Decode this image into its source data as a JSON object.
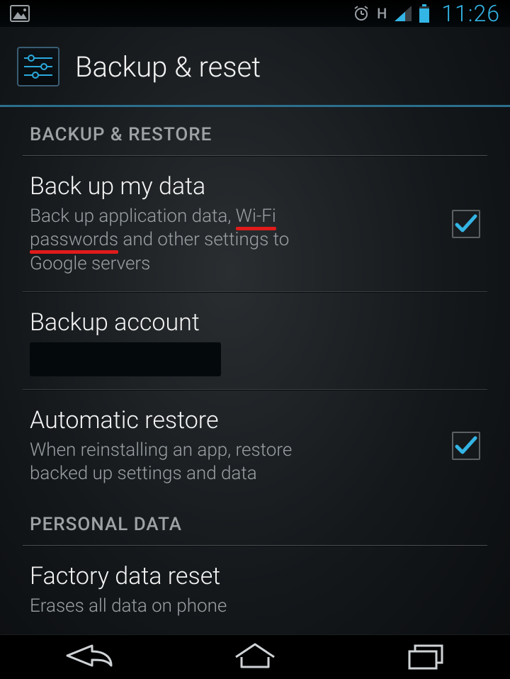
{
  "status": {
    "time": "11:26",
    "network_type": "H"
  },
  "header": {
    "title": "Backup & reset"
  },
  "sections": {
    "backup_restore": {
      "label": "BACKUP & RESTORE",
      "items": {
        "backup_my_data": {
          "title": "Back up my data",
          "sub_pre": "Back up application data, ",
          "sub_wifi": "Wi-Fi",
          "sub_mid1": " ",
          "sub_passwords": "passwords",
          "sub_post": " and other settings to Google servers",
          "checked": true
        },
        "backup_account": {
          "title": "Backup account",
          "value": ""
        },
        "automatic_restore": {
          "title": "Automatic restore",
          "sub": "When reinstalling an app, restore backed up settings and data",
          "checked": true
        }
      }
    },
    "personal_data": {
      "label": "PERSONAL DATA",
      "items": {
        "factory_reset": {
          "title": "Factory data reset",
          "sub": "Erases all data on phone"
        }
      }
    }
  },
  "colors": {
    "accent": "#33b5e5",
    "underline_rule": "#2b6f8d",
    "annotation": "#e01b1b",
    "text_primary": "#f2f2f2",
    "text_secondary": "#9aa0a4"
  }
}
